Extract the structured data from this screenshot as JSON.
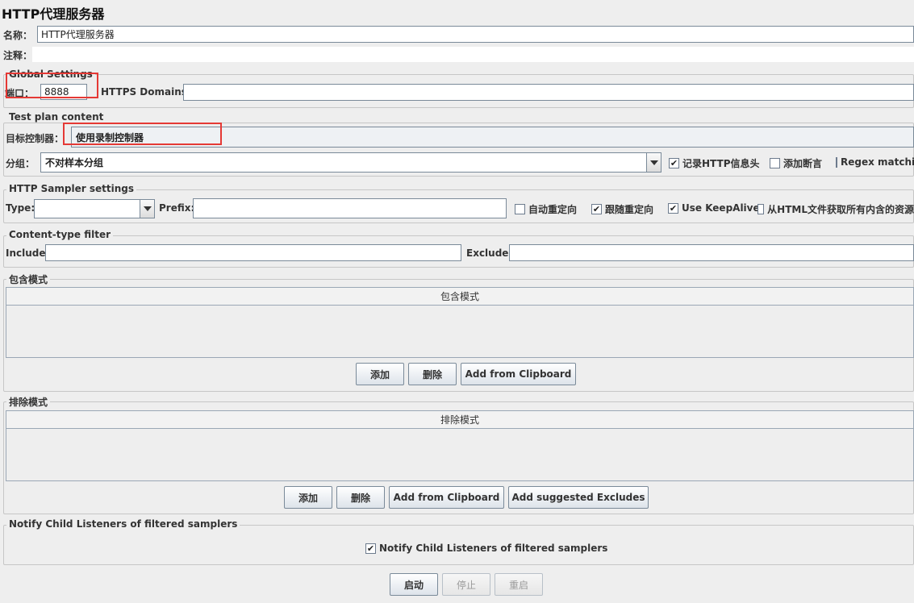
{
  "window": {
    "title": "HTTP代理服务器"
  },
  "name_field": {
    "label": "名称：",
    "value": "HTTP代理服务器"
  },
  "comment_field": {
    "label": "注释：",
    "value": ""
  },
  "global_settings": {
    "legend": "Global Settings",
    "port_label": "端口：",
    "port_value": "8888",
    "https_domains_label": "HTTPS Domains :",
    "https_domains_value": ""
  },
  "test_plan_content": {
    "legend": "Test plan content",
    "target_controller_label": "目标控制器：",
    "target_controller_value": "使用录制控制器",
    "grouping_label": "分组：",
    "grouping_value": "不对样本分组",
    "capture_http_headers_label": "记录HTTP信息头",
    "capture_http_headers_checked": true,
    "add_assertions_label": "添加断言",
    "add_assertions_checked": false,
    "regex_matching_label": "Regex matching",
    "regex_matching_checked": false
  },
  "http_sampler_settings": {
    "legend": "HTTP Sampler settings",
    "type_label": "Type:",
    "type_value": "",
    "prefix_label": "Prefix:",
    "prefix_value": "",
    "auto_redirect_label": "自动重定向",
    "auto_redirect_checked": false,
    "follow_redirects_label": "跟随重定向",
    "follow_redirects_checked": true,
    "keepalive_label": "Use KeepAlive",
    "keepalive_checked": true,
    "retrieve_embedded_label": "从HTML文件获取所有内含的资源",
    "retrieve_embedded_checked": false
  },
  "content_type_filter": {
    "legend": "Content-type filter",
    "include_label": "Include:",
    "include_value": "",
    "exclude_label": "Exclude:",
    "exclude_value": ""
  },
  "include_patterns": {
    "legend": "包含模式",
    "column_header": "包含模式",
    "add_label": "添加",
    "delete_label": "删除",
    "clipboard_label": "Add from Clipboard"
  },
  "exclude_patterns": {
    "legend": "排除模式",
    "column_header": "排除模式",
    "add_label": "添加",
    "delete_label": "删除",
    "clipboard_label": "Add from Clipboard",
    "suggested_label": "Add suggested Excludes"
  },
  "notify_section": {
    "legend": "Notify Child Listeners of filtered samplers",
    "checkbox_label": "Notify Child Listeners of filtered samplers",
    "checked": true
  },
  "control_buttons": {
    "start_label": "启动",
    "stop_label": "停止",
    "restart_label": "重启"
  },
  "colors": {
    "annotation_red": "#e53935",
    "panel_bg": "#eeeeee"
  }
}
